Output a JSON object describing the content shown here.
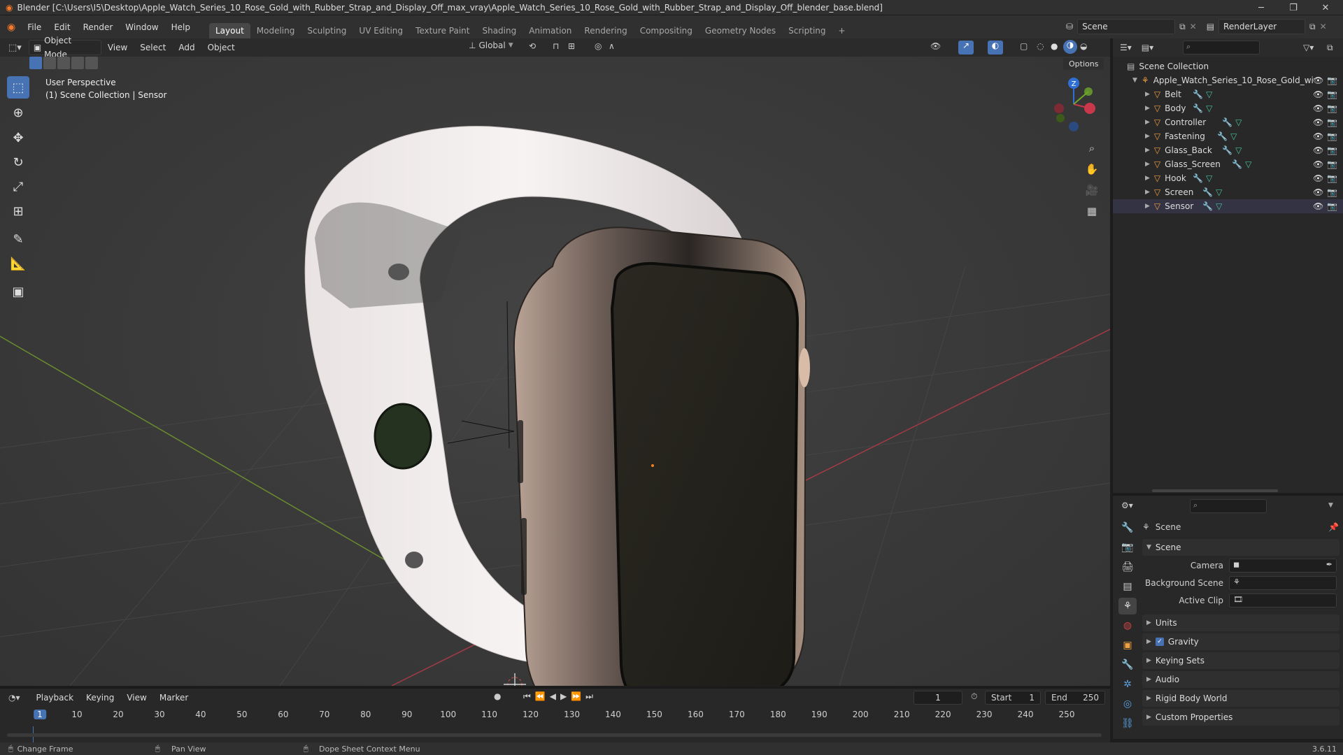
{
  "window": {
    "title": "Blender [C:\\Users\\I5\\Desktop\\Apple_Watch_Series_10_Rose_Gold_with_Rubber_Strap_and_Display_Off_max_vray\\Apple_Watch_Series_10_Rose_Gold_with_Rubber_Strap_and_Display_Off_blender_base.blend]",
    "minimize": "─",
    "restore": "❐",
    "close": "✕"
  },
  "menu": [
    "File",
    "Edit",
    "Render",
    "Window",
    "Help"
  ],
  "workspaces": [
    "Layout",
    "Modeling",
    "Sculpting",
    "UV Editing",
    "Texture Paint",
    "Shading",
    "Animation",
    "Rendering",
    "Compositing",
    "Geometry Nodes",
    "Scripting"
  ],
  "workspace_add": "+",
  "scene_selector": "Scene",
  "render_layer": "RenderLayer",
  "viewport_header": {
    "mode": "Object Mode",
    "menus": [
      "View",
      "Select",
      "Add",
      "Object"
    ],
    "transform_orientation": "Global",
    "options": "Options"
  },
  "viewport": {
    "overlay_line1": "User Perspective",
    "overlay_line2": "(1) Scene Collection | Sensor",
    "gizmo_z": "Z"
  },
  "outliner": {
    "root": "Scene Collection",
    "collection": "Apple_Watch_Series_10_Rose_Gold_wit",
    "objects": [
      "Belt",
      "Body",
      "Controller",
      "Fastening",
      "Glass_Back",
      "Glass_Screen",
      "Hook",
      "Screen",
      "Sensor"
    ]
  },
  "properties": {
    "context_title": "Scene",
    "panel_scene": "Scene",
    "camera_label": "Camera",
    "background_scene_label": "Background Scene",
    "active_clip_label": "Active Clip",
    "panels": [
      "Units",
      "Gravity",
      "Keying Sets",
      "Audio",
      "Rigid Body World",
      "Custom Properties"
    ],
    "gravity_enabled": true
  },
  "timeline": {
    "menus": [
      "Playback",
      "Keying",
      "View",
      "Marker"
    ],
    "current_frame": "1",
    "start_label": "Start",
    "start_value": "1",
    "end_label": "End",
    "end_value": "250",
    "ticks": [
      "1",
      "10",
      "20",
      "30",
      "40",
      "50",
      "60",
      "70",
      "80",
      "90",
      "100",
      "110",
      "120",
      "130",
      "140",
      "150",
      "160",
      "170",
      "180",
      "190",
      "200",
      "210",
      "220",
      "230",
      "240",
      "250"
    ]
  },
  "statusbar": {
    "left": "Change Frame",
    "mid": "Pan View",
    "right": "Dope Sheet Context Menu",
    "version": "3.6.11"
  }
}
